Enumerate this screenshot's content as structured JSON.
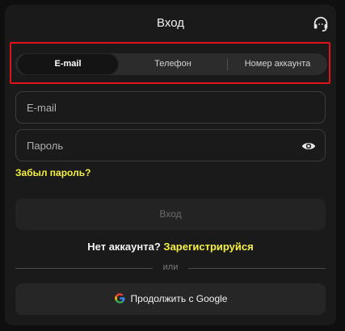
{
  "dialog": {
    "title": "Вход",
    "support_icon": "headset-icon"
  },
  "tabs": [
    {
      "label": "E-mail",
      "active": true
    },
    {
      "label": "Телефон",
      "active": false
    },
    {
      "label": "Номер аккаунта",
      "active": false
    }
  ],
  "form": {
    "email_placeholder": "E-mail",
    "email_value": "",
    "password_placeholder": "Пароль",
    "password_value": "",
    "eye_icon": "eye-icon",
    "forgot_label": "Забыл пароль?",
    "login_label": "Вход"
  },
  "register": {
    "prompt": "Нет аккаунта?",
    "link": "Зарегистрируйся"
  },
  "divider": {
    "label": "или"
  },
  "google": {
    "label": "Продолжить с Google",
    "icon": "google-icon"
  },
  "colors": {
    "accent": "#f5f041",
    "highlight_border": "#e0121c",
    "background": "#1a1a1a"
  }
}
